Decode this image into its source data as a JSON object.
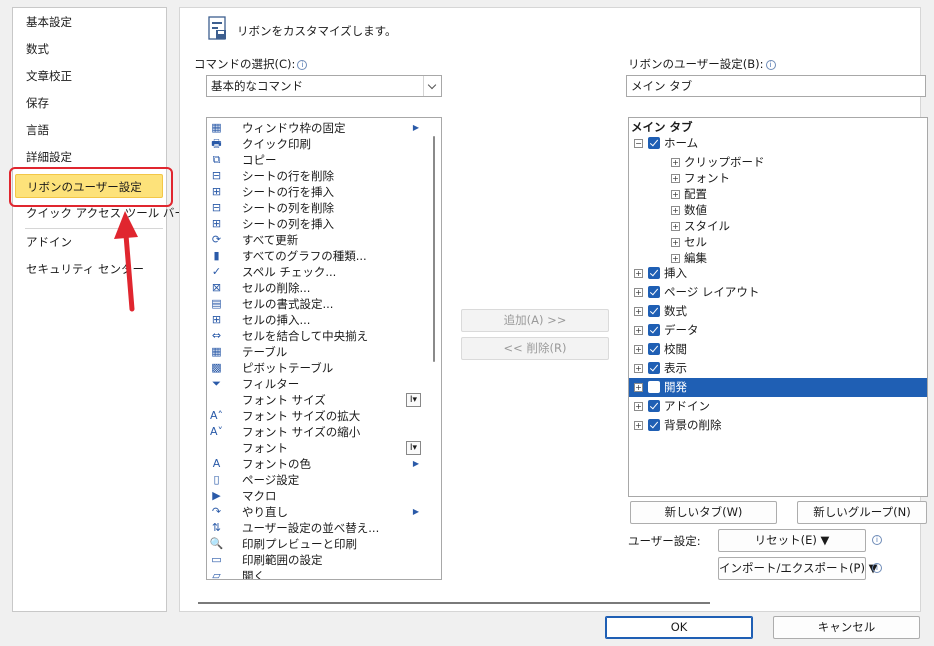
{
  "sidebar": {
    "items": [
      {
        "label": "基本設定"
      },
      {
        "label": "数式"
      },
      {
        "label": "文章校正"
      },
      {
        "label": "保存"
      },
      {
        "label": "言語"
      },
      {
        "label": "詳細設定"
      },
      {
        "label": "リボンのユーザー設定"
      },
      {
        "label": "クイック アクセス ツール バー"
      },
      {
        "label": "アドイン"
      },
      {
        "label": "セキュリティ センター"
      }
    ]
  },
  "main": {
    "heading": "リボンをカスタマイズします。",
    "commands_label": "コマンドの選択(C):",
    "commands_select_value": "基本的なコマンド",
    "ribbon_label": "リボンのユーザー設定(B):",
    "ribbon_select_value": "メイン タブ",
    "add_button": "追加(A) >>",
    "remove_button": "<< 削除(R)"
  },
  "commands": [
    {
      "icon": "freeze-panes-icon",
      "glyph": "▦",
      "label": "ウィンドウ枠の固定",
      "sub": "▶"
    },
    {
      "icon": "quick-print-icon",
      "glyph": "🖶",
      "label": "クイック印刷"
    },
    {
      "icon": "copy-icon",
      "glyph": "⧉",
      "label": "コピー"
    },
    {
      "icon": "delete-row-icon",
      "glyph": "⊟",
      "label": "シートの行を削除"
    },
    {
      "icon": "insert-row-icon",
      "glyph": "⊞",
      "label": "シートの行を挿入"
    },
    {
      "icon": "delete-column-icon",
      "glyph": "⊟",
      "label": "シートの列を削除"
    },
    {
      "icon": "insert-column-icon",
      "glyph": "⊞",
      "label": "シートの列を挿入"
    },
    {
      "icon": "refresh-all-icon",
      "glyph": "⟳",
      "label": "すべて更新"
    },
    {
      "icon": "all-charts-icon",
      "glyph": "▮",
      "label": "すべてのグラフの種類..."
    },
    {
      "icon": "spelling-icon",
      "glyph": "✓",
      "label": "スペル チェック..."
    },
    {
      "icon": "delete-cells-icon",
      "glyph": "⊠",
      "label": "セルの削除..."
    },
    {
      "icon": "format-cells-icon",
      "glyph": "▤",
      "label": "セルの書式設定..."
    },
    {
      "icon": "insert-cells-icon",
      "glyph": "⊞",
      "label": "セルの挿入..."
    },
    {
      "icon": "merge-center-icon",
      "glyph": "⇔",
      "label": "セルを結合して中央揃え"
    },
    {
      "icon": "table-icon",
      "glyph": "▦",
      "label": "テーブル"
    },
    {
      "icon": "pivot-table-icon",
      "glyph": "▩",
      "label": "ピボットテーブル"
    },
    {
      "icon": "filter-icon",
      "glyph": "⏷",
      "label": "フィルター"
    },
    {
      "icon": "font-size-icon",
      "glyph": "",
      "label": "フォント サイズ",
      "ib": "I▾"
    },
    {
      "icon": "grow-font-icon",
      "glyph": "A˄",
      "label": "フォント サイズの拡大"
    },
    {
      "icon": "shrink-font-icon",
      "glyph": "A˅",
      "label": "フォント サイズの縮小"
    },
    {
      "icon": "font-icon",
      "glyph": "",
      "label": "フォント",
      "ib": "I▾"
    },
    {
      "icon": "font-color-icon",
      "glyph": "A",
      "label": "フォントの色",
      "sub": "▶"
    },
    {
      "icon": "page-setup-icon",
      "glyph": "▯",
      "label": "ページ設定"
    },
    {
      "icon": "macro-icon",
      "glyph": "▶",
      "label": "マクロ"
    },
    {
      "icon": "redo-icon",
      "glyph": "↷",
      "label": "やり直し",
      "sub": "▶"
    },
    {
      "icon": "custom-sort-icon",
      "glyph": "⇅",
      "label": "ユーザー設定の並べ替え..."
    },
    {
      "icon": "print-preview-icon",
      "glyph": "🔍",
      "label": "印刷プレビューと印刷"
    },
    {
      "icon": "print-area-icon",
      "glyph": "▭",
      "label": "印刷範囲の設定"
    },
    {
      "icon": "open-icon",
      "glyph": "▱",
      "label": "開く"
    }
  ],
  "tree": {
    "header": "メイン タブ",
    "home": {
      "label": "ホーム",
      "children": [
        "クリップボード",
        "フォント",
        "配置",
        "数値",
        "スタイル",
        "セル",
        "編集"
      ]
    },
    "tabs": [
      {
        "label": "挿入",
        "checked": true
      },
      {
        "label": "ページ レイアウト",
        "checked": true
      },
      {
        "label": "数式",
        "checked": true
      },
      {
        "label": "データ",
        "checked": true
      },
      {
        "label": "校閲",
        "checked": true
      },
      {
        "label": "表示",
        "checked": true
      },
      {
        "label": "開発",
        "checked": false
      },
      {
        "label": "アドイン",
        "checked": true
      },
      {
        "label": "背景の削除",
        "checked": true
      }
    ]
  },
  "bottom": {
    "new_tab": "新しいタブ(W)",
    "new_group": "新しいグループ(N)",
    "user_settings_label": "ユーザー設定:",
    "reset": "リセット(E) ▼",
    "import_export": "インポート/エクスポート(P) ▼",
    "ok": "OK",
    "cancel": "キャンセル"
  },
  "colors": {
    "selection": "#1f5fb4",
    "nav_selected": "#fde27a",
    "highlight": "#e0262f"
  }
}
